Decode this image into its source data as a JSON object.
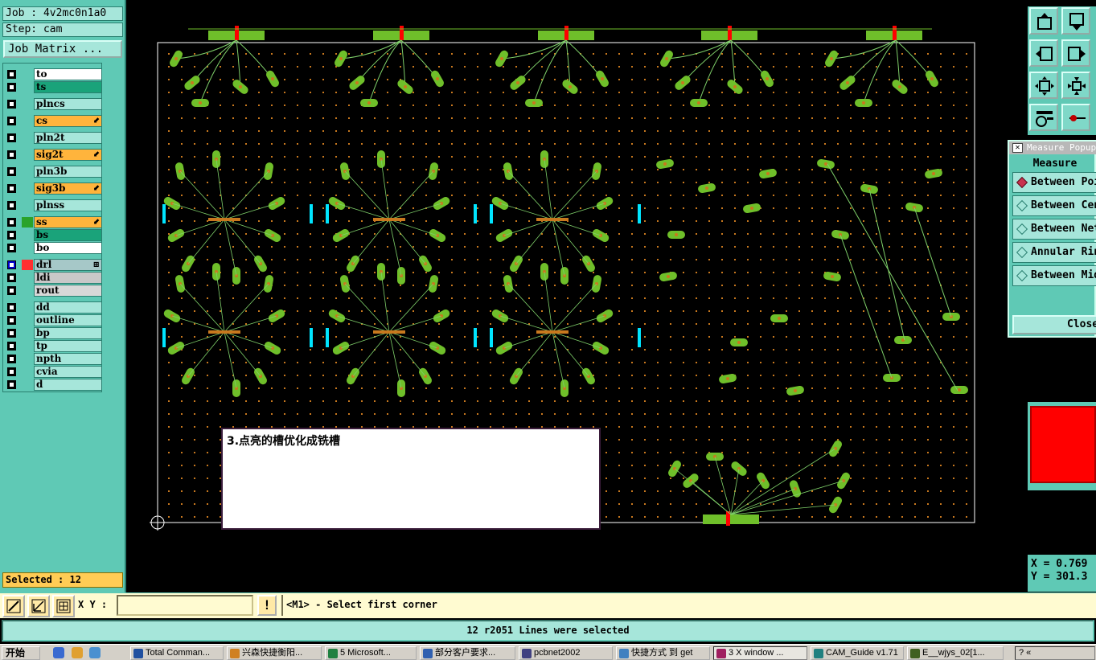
{
  "job": {
    "job_line": "Job : 4v2mc0n1a0",
    "step_line": "Step: cam",
    "matrix_button": "Job Matrix ..."
  },
  "layers": [
    {
      "name": "to",
      "color": "#ffffff",
      "swatch": "#5fc9b5",
      "mark": ""
    },
    {
      "name": "ts",
      "color": "#1aa37a",
      "swatch": "#5fc9b5",
      "mark": ""
    },
    {
      "name": "plncs",
      "color": "#a6e6da",
      "swatch": "#5fc9b5",
      "mark": ""
    },
    {
      "name": "cs",
      "color": "#ffb43c",
      "swatch": "#5fc9b5",
      "mark": "⬋"
    },
    {
      "name": "pln2t",
      "color": "#a6e6da",
      "swatch": "#5fc9b5",
      "mark": ""
    },
    {
      "name": "sig2t",
      "color": "#ffb43c",
      "swatch": "#5fc9b5",
      "mark": "⬋"
    },
    {
      "name": "pln3b",
      "color": "#a6e6da",
      "swatch": "#5fc9b5",
      "mark": ""
    },
    {
      "name": "sig3b",
      "color": "#ffb43c",
      "swatch": "#5fc9b5",
      "mark": "⬋"
    },
    {
      "name": "plnss",
      "color": "#a6e6da",
      "swatch": "#5fc9b5",
      "mark": ""
    },
    {
      "name": "ss",
      "color": "#ffb43c",
      "swatch": "#2aa32a",
      "mark": "⬋"
    },
    {
      "name": "bs",
      "color": "#1aa37a",
      "swatch": "#5fc9b5",
      "mark": ""
    },
    {
      "name": "bo",
      "color": "#ffffff",
      "swatch": "#5fc9b5",
      "mark": ""
    },
    {
      "name": "drl",
      "color": "#a6c8c8",
      "swatch": "#ff3030",
      "mark": "⊞"
    },
    {
      "name": "ldi",
      "color": "#c8c8c8",
      "swatch": "#5fc9b5",
      "mark": ""
    },
    {
      "name": "rout",
      "color": "#d8d8d8",
      "swatch": "#5fc9b5",
      "mark": ""
    },
    {
      "name": "dd",
      "color": "#a6e6da",
      "swatch": "#5fc9b5",
      "mark": ""
    },
    {
      "name": "outline",
      "color": "#a6e6da",
      "swatch": "#5fc9b5",
      "mark": ""
    },
    {
      "name": "bp",
      "color": "#a6e6da",
      "swatch": "#5fc9b5",
      "mark": ""
    },
    {
      "name": "tp",
      "color": "#a6e6da",
      "swatch": "#5fc9b5",
      "mark": ""
    },
    {
      "name": "npth",
      "color": "#a6e6da",
      "swatch": "#5fc9b5",
      "mark": ""
    },
    {
      "name": "cvia",
      "color": "#a6e6da",
      "swatch": "#5fc9b5",
      "mark": ""
    },
    {
      "name": "d",
      "color": "#a6e6da",
      "swatch": "#5fc9b5",
      "mark": ""
    }
  ],
  "selected_label": "Selected : 12",
  "measure": {
    "title": "Measure Popup",
    "header": "Measure",
    "options": [
      {
        "label": "Between Points",
        "selected": true
      },
      {
        "label": "Between Centers",
        "selected": false
      },
      {
        "label": "Between Nets",
        "selected": false
      },
      {
        "label": "Annular Ring",
        "selected": false
      },
      {
        "label": "Between Mid",
        "selected": false
      }
    ],
    "close": "Close"
  },
  "coords": {
    "x": "X = 0.769",
    "y": "Y = 301.3"
  },
  "input_bar": {
    "xy_label": "X Y :",
    "xy_value": "",
    "warn": "!",
    "prompt": "<M1> - Select first corner"
  },
  "status": "12 r2051 Lines were selected",
  "note": "3.点亮的槽优化成铣槽",
  "colors": {
    "panel": "#5fc9b5",
    "pad": "#6fbf2a",
    "dot": "#c8781e",
    "trace": "#7fd06a",
    "cyan": "#00e5ff",
    "red": "#ff0000"
  },
  "taskbar": {
    "start": "开始",
    "tasks": [
      {
        "label": "Total Comman...",
        "active": false
      },
      {
        "label": "兴森快捷衡阳...",
        "active": false
      },
      {
        "label": "5 Microsoft...",
        "active": false
      },
      {
        "label": "部分客户要求...",
        "active": false
      },
      {
        "label": "pcbnet2002",
        "active": false
      },
      {
        "label": "快捷方式 到 get",
        "active": false
      },
      {
        "label": "3 X window ...",
        "active": true
      },
      {
        "label": "CAM_Guide v1.71",
        "active": false
      },
      {
        "label": "E__wjys_02[1...",
        "active": false
      }
    ],
    "tray": "?  «"
  }
}
